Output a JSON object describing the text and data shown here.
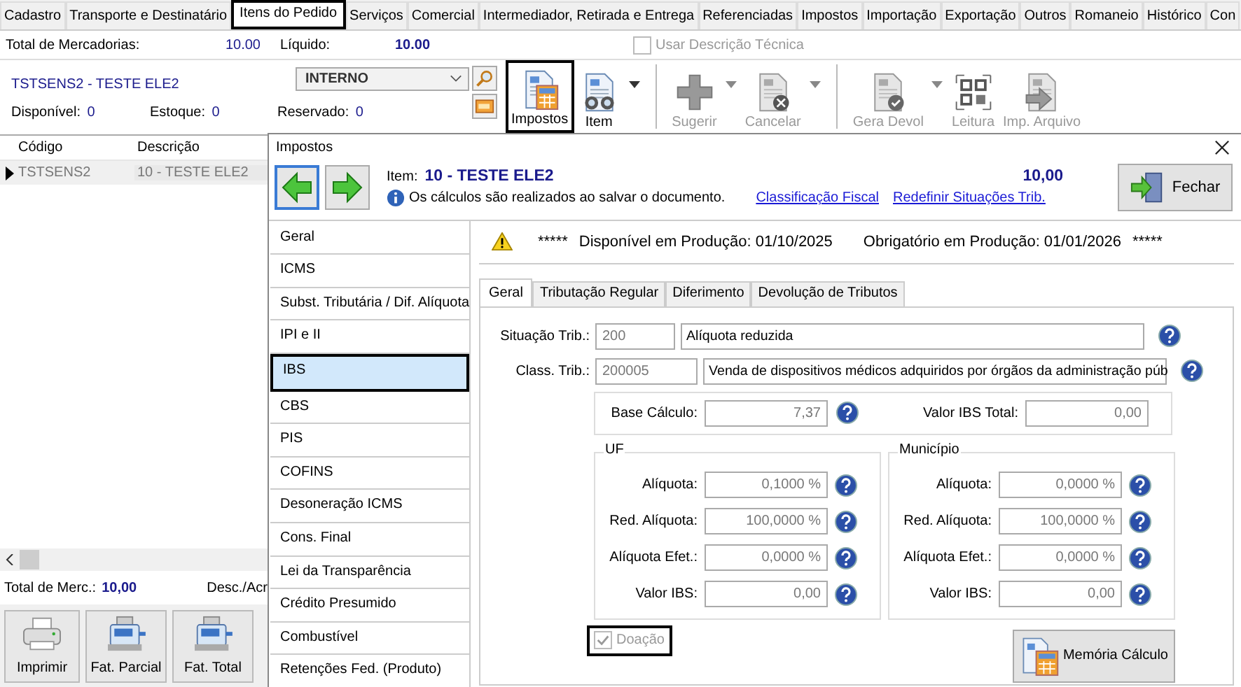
{
  "main_tabs": [
    {
      "label": "Cadastro",
      "selected": false
    },
    {
      "label": "Transporte e Destinatário",
      "selected": false
    },
    {
      "label": "Itens do Pedido",
      "selected": true
    },
    {
      "label": "Serviços",
      "selected": false
    },
    {
      "label": "Comercial",
      "selected": false
    },
    {
      "label": "Intermediador, Retirada e Entrega",
      "selected": false
    },
    {
      "label": "Referenciadas",
      "selected": false
    },
    {
      "label": "Impostos",
      "selected": false
    },
    {
      "label": "Importação",
      "selected": false
    },
    {
      "label": "Exportação",
      "selected": false
    },
    {
      "label": "Outros",
      "selected": false
    },
    {
      "label": "Romaneio",
      "selected": false
    },
    {
      "label": "Histórico",
      "selected": false
    },
    {
      "label": "Con",
      "selected": false
    }
  ],
  "totals": {
    "mercadorias_label": "Total de Mercadorias:",
    "mercadorias_value": "10.00",
    "liquido_label": "Líquido:",
    "liquido_value": "10.00"
  },
  "usar_descricao": {
    "label": "Usar Descrição Técnica",
    "checked": false
  },
  "product": {
    "title": "TSTSENS2 - TESTE ELE2",
    "select": "INTERNO",
    "stock": [
      {
        "label": "Disponível:",
        "value": "0"
      },
      {
        "label": "Estoque:",
        "value": "0"
      },
      {
        "label": "Reservado:",
        "value": "0"
      }
    ]
  },
  "toolbar": [
    {
      "label": "Impostos",
      "kind": "calculator",
      "disabled": false,
      "dropdown": false,
      "highlighted": true,
      "sep_before": false
    },
    {
      "label": "Item",
      "kind": "binoculars",
      "disabled": false,
      "dropdown": true,
      "highlighted": false,
      "sep_before": false
    },
    {
      "label": "Sugerir",
      "kind": "plus",
      "disabled": true,
      "dropdown": true,
      "highlighted": false,
      "sep_before": true
    },
    {
      "label": "Cancelar",
      "kind": "cancel",
      "disabled": true,
      "dropdown": true,
      "highlighted": false,
      "sep_before": false
    },
    {
      "label": "Gera Devol",
      "kind": "check",
      "disabled": true,
      "dropdown": true,
      "highlighted": false,
      "sep_before": true
    },
    {
      "label": "Leitura",
      "kind": "qr",
      "disabled": true,
      "dropdown": false,
      "highlighted": false,
      "sep_before": false
    },
    {
      "label": "Imp. Arquivo",
      "kind": "import",
      "disabled": true,
      "dropdown": false,
      "highlighted": false,
      "sep_before": false
    }
  ],
  "grid": {
    "columns": [
      "Código",
      "Descrição"
    ],
    "rows": [
      {
        "cells": [
          "TSTSENS2",
          "10 - TESTE ELE2"
        ],
        "selected": true
      }
    ]
  },
  "footer": {
    "total_label": "Total de Merc.:",
    "total_value": "10,00",
    "desc_label": "Desc./Acr"
  },
  "bottom_buttons": [
    {
      "label": "Imprimir",
      "kind": "printer"
    },
    {
      "label": "Fat. Parcial",
      "kind": "register"
    },
    {
      "label": "Fat. Total",
      "kind": "register"
    }
  ],
  "dialog": {
    "title": "Impostos",
    "item_label": "Item:",
    "item_name": "10 - TESTE ELE2",
    "note": "Os cálculos são realizados ao salvar o documento.",
    "links": [
      "Classificação Fiscal",
      "Redefinir Situações Trib."
    ],
    "total": "10,00",
    "close_button": "Fechar",
    "nav": [
      {
        "label": "Geral",
        "selected": false
      },
      {
        "label": "ICMS",
        "selected": false
      },
      {
        "label": "Subst. Tributária / Dif. Alíquota",
        "selected": false
      },
      {
        "label": "IPI e II",
        "selected": false
      },
      {
        "label": "IBS",
        "selected": true
      },
      {
        "label": "CBS",
        "selected": false
      },
      {
        "label": "PIS",
        "selected": false
      },
      {
        "label": "COFINS",
        "selected": false
      },
      {
        "label": "Desoneração ICMS",
        "selected": false
      },
      {
        "label": "Cons. Final",
        "selected": false
      },
      {
        "label": "Lei da Transparência",
        "selected": false
      },
      {
        "label": "Crédito Presumido",
        "selected": false
      },
      {
        "label": "Combustível",
        "selected": false
      },
      {
        "label": "Retenções Fed. (Produto)",
        "selected": false
      }
    ],
    "warning": {
      "stars_left": "*****",
      "available": "Disponível em Produção: 01/10/2025",
      "mandatory": "Obrigatório em Produção: 01/01/2026",
      "stars_right": "*****"
    },
    "tabs": [
      {
        "label": "Geral",
        "selected": true
      },
      {
        "label": "Tributação Regular",
        "selected": false
      },
      {
        "label": "Diferimento",
        "selected": false
      },
      {
        "label": "Devolução de Tributos",
        "selected": false
      }
    ],
    "situacao": {
      "label": "Situação Trib.:",
      "code": "200",
      "description": "Alíquota reduzida"
    },
    "classificacao": {
      "label": "Class. Trib.:",
      "code": "200005",
      "description": "Venda de dispositivos médicos adquiridos por órgãos da administração púb"
    },
    "base": {
      "label": "Base Cálculo:",
      "value": "7,37"
    },
    "total_ibs": {
      "label": "Valor IBS Total:",
      "value": "0,00"
    },
    "groups": [
      {
        "title": "UF",
        "fields": [
          {
            "label": "Alíquota:",
            "value": "0,1000 %"
          },
          {
            "label": "Red. Alíquota:",
            "value": "100,0000 %"
          },
          {
            "label": "Alíquota Efet.:",
            "value": "0,0000 %"
          },
          {
            "label": "Valor IBS:",
            "value": "0,00"
          }
        ]
      },
      {
        "title": "Município",
        "fields": [
          {
            "label": "Alíquota:",
            "value": "0,0000 %"
          },
          {
            "label": "Red. Alíquota:",
            "value": "100,0000 %"
          },
          {
            "label": "Alíquota Efet.:",
            "value": "0,0000 %"
          },
          {
            "label": "Valor IBS:",
            "value": "0,00"
          }
        ]
      }
    ],
    "doacao": {
      "label": "Doação",
      "checked": true,
      "disabled": true,
      "highlighted": true
    },
    "memoria_button": "Memória Cálculo"
  }
}
